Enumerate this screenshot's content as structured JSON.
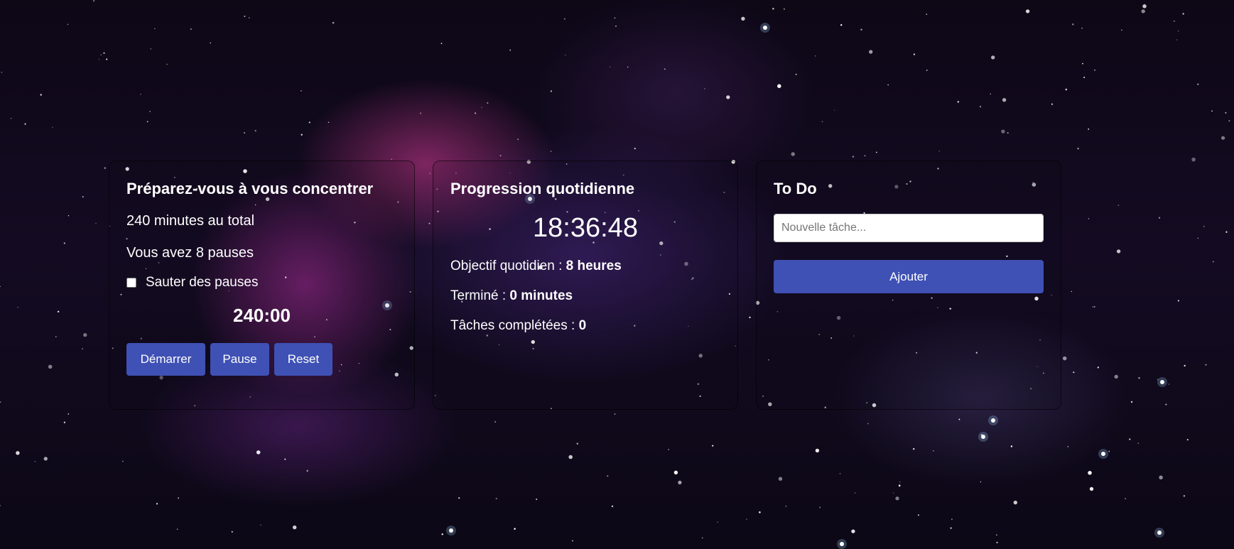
{
  "focus": {
    "title": "Préparez-vous à vous concentrer",
    "total": "240 minutes au total",
    "pauses": "Vous avez 8 pauses",
    "skip_label": "Sauter des pauses",
    "skip_checked": false,
    "timer": "240:00",
    "buttons": {
      "start": "Démarrer",
      "pause": "Pause",
      "reset": "Reset"
    }
  },
  "progress": {
    "title": "Progression quotidienne",
    "clock": "18:36:48",
    "goal_label": "Objectif quotidien : ",
    "goal_value": "8 heures",
    "done_label": "Terminé : ",
    "done_value": "0 minutes",
    "tasks_label": "Tâches complétées : ",
    "tasks_value": "0"
  },
  "todo": {
    "title": "To Do",
    "input_placeholder": "Nouvelle tâche...",
    "input_value": "",
    "add_label": "Ajouter"
  },
  "colors": {
    "button": "#3f51b5",
    "text": "#ffffff"
  }
}
